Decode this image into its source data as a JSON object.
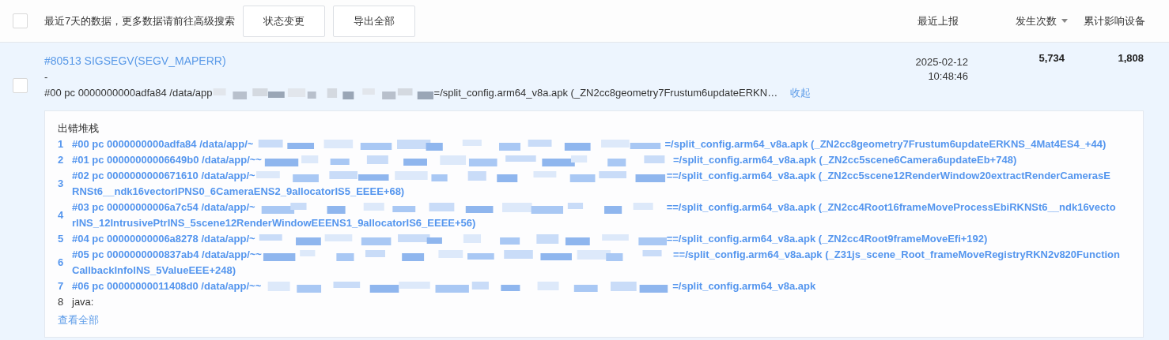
{
  "toolbar": {
    "checked": false,
    "notice": "最近7天的数据，更多数据请前往高级搜索",
    "buttons": [
      "状态变更",
      "导出全部"
    ]
  },
  "columns": [
    {
      "label": "最近上报",
      "sortable": false
    },
    {
      "label": "发生次数",
      "sortable": true
    },
    {
      "label": "累计影响设备",
      "sortable": false
    }
  ],
  "issue": {
    "checked": false,
    "title": "#80513 SIGSEGV(SEGV_MAPERR)",
    "subtitle": "-",
    "frame_before": "#00 pc 0000000000adfa84 /data/app",
    "frame_after": "=/split_config.arm64_v8a.apk (_ZN2cc8geometry7Frustum6updateERKN…",
    "collapse_link": "收起",
    "last_report": [
      "2025-02-12",
      "10:48:46"
    ],
    "count": "5,734",
    "devices": "1,808",
    "stack": {
      "title": "出错堆栈",
      "more_link": "查看全部",
      "lines": [
        {
          "kind": "native",
          "number": "1",
          "before": "#00 pc 0000000000adfa84 /data/app/~",
          "after": "=/split_config.arm64_v8a.apk (_ZN2cc8geometry7Frustum6updateERKNS_4Mat4ES4_+44)"
        },
        {
          "kind": "native",
          "number": "2",
          "before": "#01 pc 00000000006649b0 /data/app/~~",
          "after": "=/split_config.arm64_v8a.apk (_ZN2cc5scene6Camera6updateEb+748)"
        },
        {
          "kind": "native",
          "number": "3",
          "before": "#02 pc 0000000000671610 /data/app/~",
          "after": "==/split_config.arm64_v8a.apk (_ZN2cc5scene12RenderWindow20extractRenderCamerasE",
          "continuation": "RNSt6__ndk16vectorIPNS0_6CameraENS2_9allocatorIS5_EEEE+68)"
        },
        {
          "kind": "native",
          "number": "4",
          "before": "#03 pc 00000000006a7c54 /data/app/~",
          "after": "==/split_config.arm64_v8a.apk (_ZN2cc4Root16frameMoveProcessEbiRKNSt6__ndk16vecto",
          "continuation": "rINS_12IntrusivePtrINS_5scene12RenderWindowEEENS1_9allocatorIS6_EEEE+56)"
        },
        {
          "kind": "native",
          "number": "5",
          "before": "#04 pc 00000000006a8278 /data/app/~",
          "after": "==/split_config.arm64_v8a.apk (_ZN2cc4Root9frameMoveEfi+192)"
        },
        {
          "kind": "native",
          "number": "6",
          "before": "#05 pc 0000000000837ab4 /data/app/~~",
          "after": "==/split_config.arm64_v8a.apk (_Z31js_scene_Root_frameMoveRegistryRKN2v820Function",
          "continuation": "CallbackInfoINS_5ValueEEE+248)"
        },
        {
          "kind": "native",
          "number": "7",
          "before": "#06 pc 00000000011408d0 /data/app/~~",
          "after": "=/split_config.arm64_v8a.apk"
        },
        {
          "kind": "plain",
          "number": "8",
          "before": "java:"
        }
      ]
    }
  }
}
